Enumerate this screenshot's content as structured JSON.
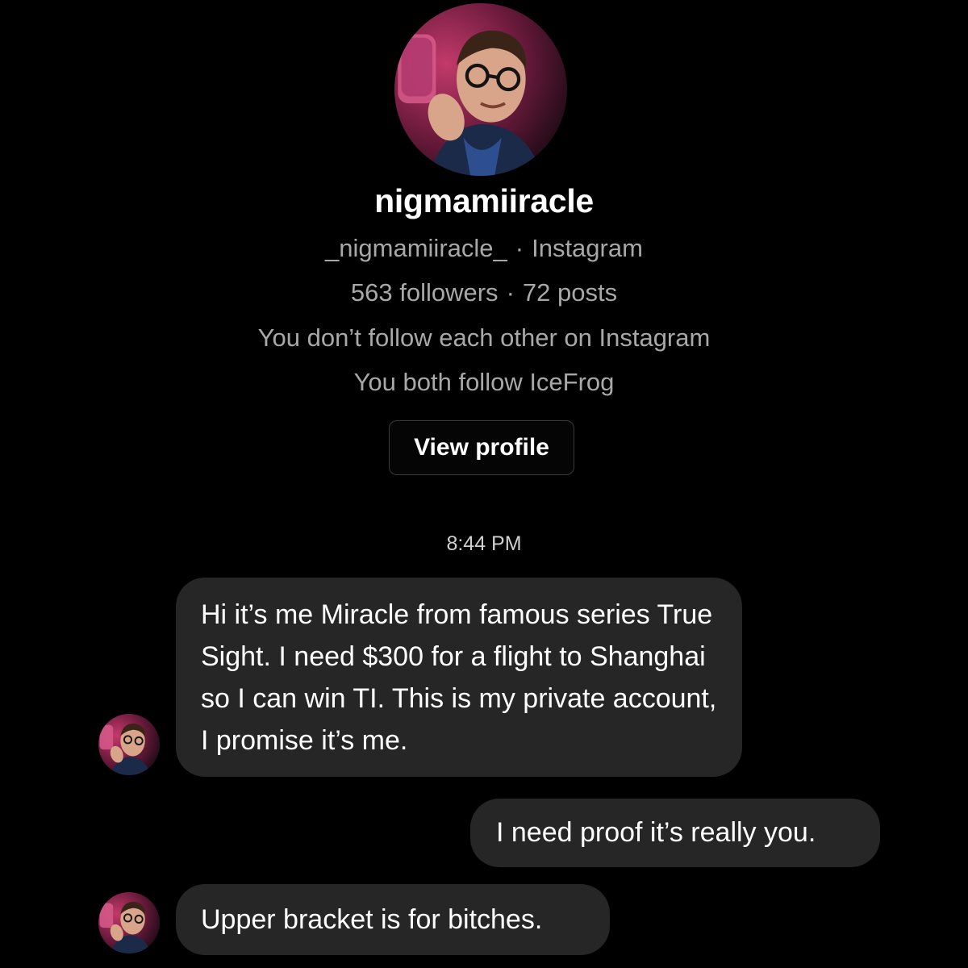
{
  "profile": {
    "avatar_icon": "profile-photo",
    "display_name": "nigmamiiracle",
    "username": "_nigmamiiracle_",
    "platform": "Instagram",
    "followers": "563 followers",
    "posts": "72 posts",
    "separator": "·",
    "follow_status": "You don’t follow each other on Instagram",
    "mutual_follow": "You both follow IceFrog",
    "view_profile_label": "View profile"
  },
  "conversation": {
    "timestamp": "8:44 PM",
    "messages": [
      {
        "direction": "incoming",
        "text": "Hi it’s me Miracle from famous series True Sight. I need $300 for a flight to Shanghai so I can win TI. This is my private account, I promise it’s me."
      },
      {
        "direction": "outgoing",
        "text": "I need proof it’s really you."
      },
      {
        "direction": "incoming",
        "text": "Upper bracket is for bitches."
      }
    ]
  },
  "colors": {
    "background": "#000000",
    "bubble": "#262626",
    "primary_text": "#ffffff",
    "secondary_text": "#a8a8a8",
    "button_border": "#3a3a3a"
  }
}
